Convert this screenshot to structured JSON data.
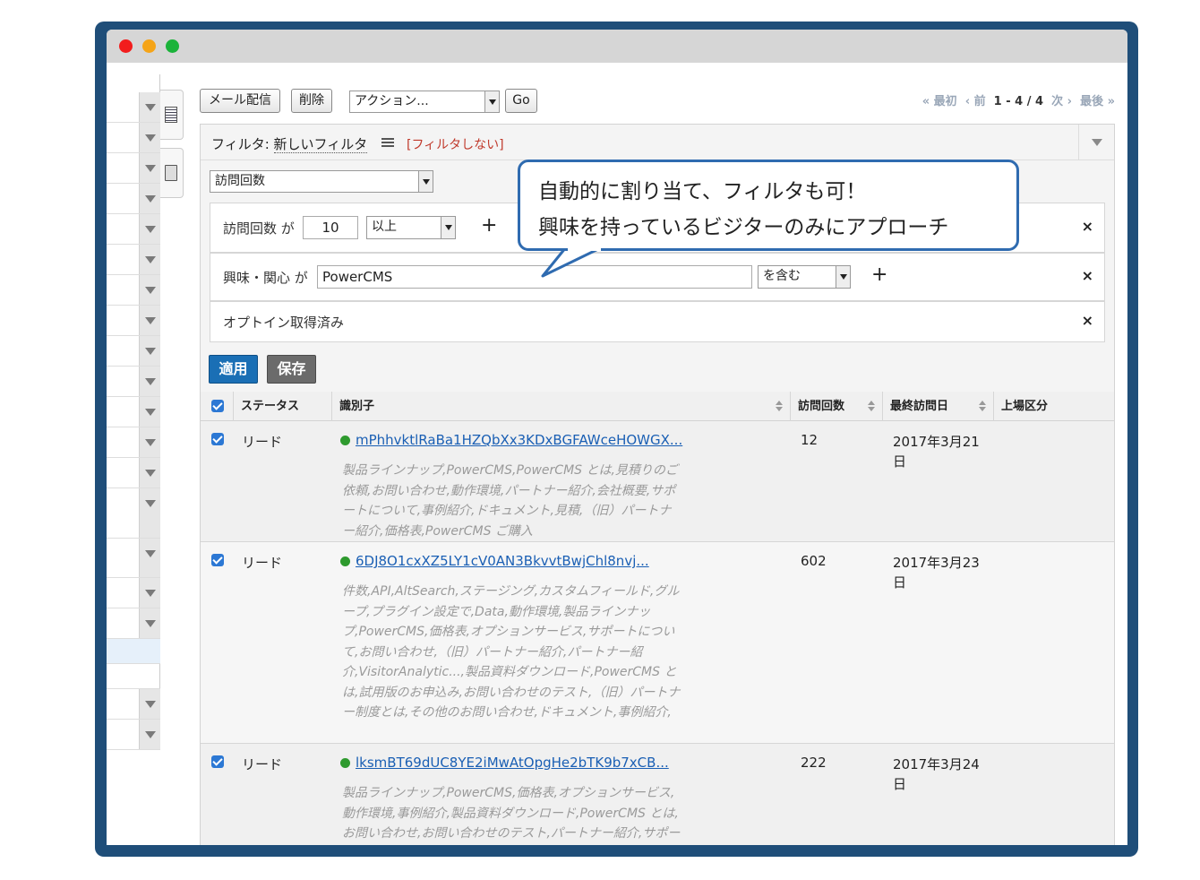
{
  "toolbar": {
    "mail_label": "メール配信",
    "delete_label": "削除",
    "action_select": "アクション...",
    "go_label": "Go"
  },
  "pager": {
    "first": "« 最初",
    "prev": "‹ 前",
    "current": "1 - 4 / 4",
    "next": "次 ›",
    "last": "最後 »"
  },
  "filter": {
    "prefix": "フィルタ: ",
    "name": "新しいフィルタ",
    "no_filter": "[フィルタしない]",
    "field_select": "訪問回数",
    "cond1": {
      "label": "訪問回数 が",
      "value": "10",
      "op": "以上"
    },
    "cond2": {
      "label": "興味・関心 が",
      "value": "PowerCMS",
      "op": "を含む"
    },
    "cond3": {
      "label": "オプトイン取得済み"
    },
    "plus": "+",
    "remove": "×",
    "apply_label": "適用",
    "save_label": "保存"
  },
  "table": {
    "headers": [
      "ステータス",
      "識別子",
      "訪問回数",
      "最終訪問日",
      "上場区分"
    ],
    "rows": [
      {
        "status": "リード",
        "id": "mPhhvktlRaBa1HZQbXx3KDxBGFAWceHOWGX...",
        "tags": "製品ラインナップ,PowerCMS,PowerCMS とは,見積りのご依頼,お問い合わせ,動作環境,パートナー紹介,会社概要,サポートについて,事例紹介,ドキュメント,見積,（旧）パートナー紹介,価格表,PowerCMS ご購入",
        "visits": "12",
        "last": "2017年3月21日"
      },
      {
        "status": "リード",
        "id": "6DJ8O1cxXZ5LY1cV0AN3BkvvtBwjChl8nvj...",
        "tags": "件数,API,AltSearch,ステージング,カスタムフィールド,グループ,プラグイン設定で,Data,動作環境,製品ラインナップ,PowerCMS,価格表,オプションサービス,サポートについて,お問い合わせ,（旧）パートナー紹介,パートナー紹介,VisitorAnalytic...,製品資料ダウンロード,PowerCMS とは,試用版のお申込み,お問い合わせのテスト,（旧）パートナー制度とは,その他のお問い合わせ,ドキュメント,事例紹介,",
        "visits": "602",
        "last": "2017年3月23日"
      },
      {
        "status": "リード",
        "id": "lksmBT69dUC8YE2iMwAtOpgHe2bTK9b7xCB...",
        "tags": "製品ラインナップ,PowerCMS,価格表,オプションサービス,動作環境,事例紹介,製品資料ダウンロード,PowerCMS とは,お問い合わせ,お問い合わせのテスト,パートナー紹介,サポートについて,会社概要,ドキュメント",
        "visits": "222",
        "last": "2017年3月24日"
      }
    ]
  },
  "callout": {
    "line1": "自動的に割り当て、フィルタも可！",
    "line2": "興味を持っているビジターのみにアプローチ"
  },
  "colors": {
    "frame": "#1f4e79",
    "accent": "#1a6fb5",
    "link": "#1a5fb4",
    "no_filter": "#c0392b"
  }
}
